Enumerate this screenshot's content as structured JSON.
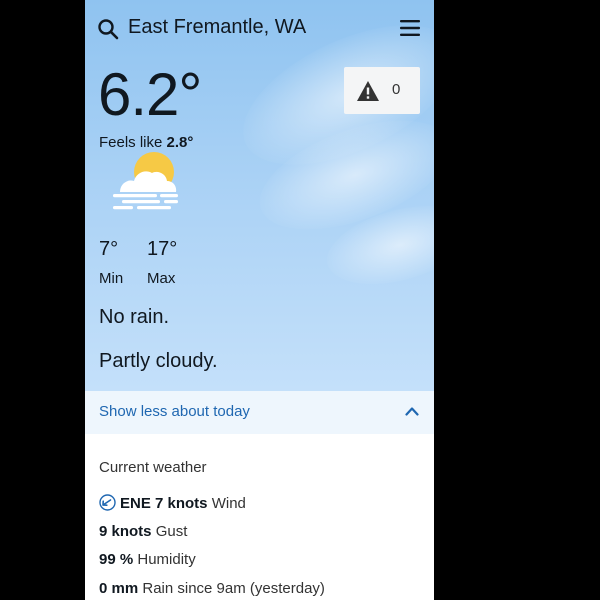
{
  "header": {
    "location": "East Fremantle, WA",
    "search_icon": "search-icon",
    "menu_icon": "hamburger-menu-icon"
  },
  "current": {
    "temperature": "6.2°",
    "feels_like_label": "Feels like",
    "feels_like_value": "2.8°",
    "weather_icon": "partly-cloudy-sun-icon",
    "min_value": "7°",
    "min_label": "Min",
    "max_value": "17°",
    "max_label": "Max",
    "rain": "No rain.",
    "description": "Partly cloudy."
  },
  "warnings": {
    "icon": "warning-triangle-icon",
    "count": "0"
  },
  "toggle": {
    "label": "Show less about today",
    "icon": "chevron-up-icon"
  },
  "current_weather": {
    "title": "Current weather",
    "wind": {
      "icon": "wind-direction-icon",
      "value": "ENE 7 knots",
      "label": "Wind"
    },
    "gust": {
      "value": "9 knots",
      "label": "Gust"
    },
    "humidity": {
      "value": "99 %",
      "label": "Humidity"
    },
    "rain_since": {
      "value": "0 mm",
      "label": "Rain since 9am (yesterday)"
    }
  },
  "colors": {
    "hero_top": "#8fc3f0",
    "hero_bottom": "#c4e0fa",
    "link_blue": "#1f67b1",
    "toggle_bg": "#eef6fd",
    "text_dark": "#101820"
  }
}
